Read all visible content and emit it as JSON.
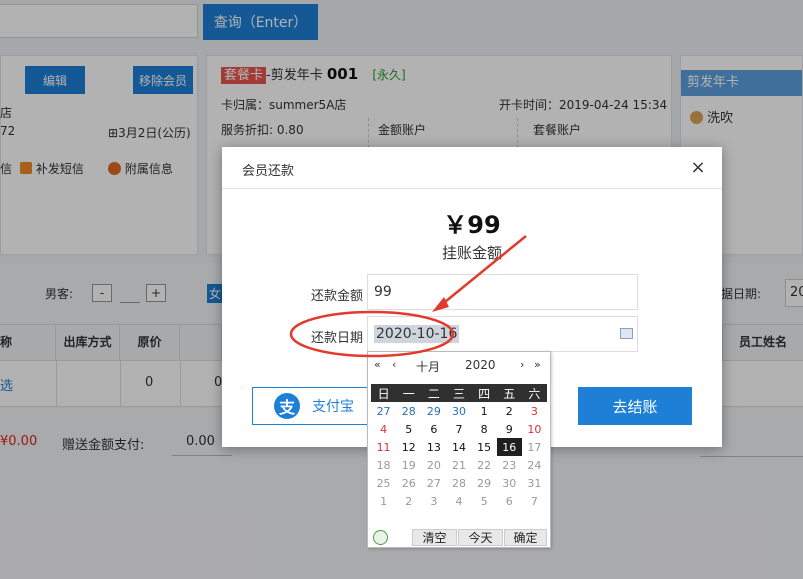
{
  "top": {
    "query_button": "查询（Enter）"
  },
  "left_panel": {
    "edit_button": "编辑",
    "remove_button": "移除会员",
    "store_fragment": "店",
    "phone_fragment": "72",
    "birthday": "3月2日(公历)",
    "sms_fragment": "信",
    "resend_sms": "补发短信",
    "extra_info": "附属信息"
  },
  "card": {
    "type_tag": "套餐卡",
    "name_prefix": "-剪发年卡",
    "number": "001",
    "validity": "[永久]",
    "store": "卡归属：summer5A店",
    "open_time": "开卡时间：2019-04-24 15:34",
    "discount": "服务折扣: 0.80",
    "amount_account": "金额账户",
    "package_account": "套餐账户"
  },
  "right_card": {
    "title": "剪发年卡",
    "service": "洗吹"
  },
  "filters": {
    "male_label": "男客:",
    "minus": "-",
    "plus": "+",
    "female_fragment": "女",
    "date_label": "据日期:",
    "date_fragment": "20"
  },
  "table": {
    "headers": [
      "称",
      "出库方式",
      "原价",
      "",
      "员工姓名"
    ],
    "row": {
      "select": "选",
      "price": "0",
      "price2": "0"
    }
  },
  "footer": {
    "amount": "¥0.00",
    "gift_label": "赠送金额支付:",
    "gift_value": "0.00"
  },
  "modal": {
    "title": "会员还款",
    "close": "×",
    "amount": "￥99",
    "amount_label": "挂账金额",
    "repay_amount_label": "还款金额",
    "repay_amount_value": "99",
    "repay_date_label": "还款日期",
    "repay_date_value": "2020-10-16",
    "alipay_logo": "支",
    "alipay_label": "支付宝",
    "checkout_label": "去结账"
  },
  "calendar": {
    "prev_year": "«",
    "prev_month": "‹",
    "month": "十月",
    "year": "2020",
    "next_month": "›",
    "next_year": "»",
    "weekdays": [
      "日",
      "一",
      "二",
      "三",
      "四",
      "五",
      "六"
    ],
    "weeks": [
      [
        "27",
        "28",
        "29",
        "30",
        "1",
        "2",
        "3"
      ],
      [
        "4",
        "5",
        "6",
        "7",
        "8",
        "9",
        "10"
      ],
      [
        "11",
        "12",
        "13",
        "14",
        "15",
        "16",
        "17"
      ],
      [
        "18",
        "19",
        "20",
        "21",
        "22",
        "23",
        "24"
      ],
      [
        "25",
        "26",
        "27",
        "28",
        "29",
        "30",
        "31"
      ],
      [
        "1",
        "2",
        "3",
        "4",
        "5",
        "6",
        "7"
      ]
    ],
    "selected_day": "16",
    "clear_label": "清空",
    "today_label": "今天",
    "ok_label": "确定"
  },
  "colors": {
    "primary": "#1e7fd6",
    "red_tag": "#e9554d",
    "annotation_red": "#e23a2e",
    "green_text": "#2f9a2f"
  }
}
